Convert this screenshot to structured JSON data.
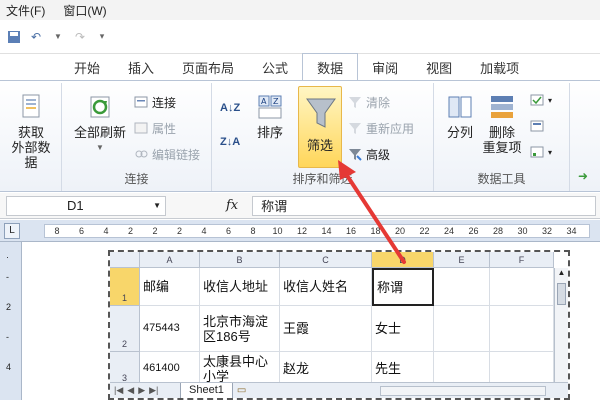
{
  "menubar": {
    "items": [
      "文件(F)",
      "窗口(W)"
    ]
  },
  "tabs": [
    {
      "label": "开始"
    },
    {
      "label": "插入"
    },
    {
      "label": "页面布局"
    },
    {
      "label": "公式"
    },
    {
      "label": "数据",
      "active": true
    },
    {
      "label": "审阅"
    },
    {
      "label": "视图"
    },
    {
      "label": "加载项"
    }
  ],
  "ribbon": {
    "get_external": {
      "label1": "获取",
      "label2": "外部数据"
    },
    "connections": {
      "refresh_all": "全部刷新",
      "connect": "连接",
      "properties": "属性",
      "edit_links": "编辑链接",
      "group_label": "连接"
    },
    "sort_filter": {
      "sort": "排序",
      "filter": "筛选",
      "clear": "清除",
      "reapply": "重新应用",
      "advanced": "高级",
      "group_label": "排序和筛选"
    },
    "data_tools": {
      "split": "分列",
      "remove_dup_1": "删除",
      "remove_dup_2": "重复项",
      "group_label": "数据工具"
    }
  },
  "formula_bar": {
    "name_box": "D1",
    "fx": "fx",
    "content": "称谓"
  },
  "ruler": {
    "numbers": [
      "8",
      "6",
      "4",
      "2",
      "2",
      "2",
      "4",
      "6",
      "8",
      "10",
      "12",
      "14",
      "16",
      "18",
      "20",
      "22",
      "24",
      "26",
      "28",
      "30",
      "32",
      "34"
    ]
  },
  "sheet": {
    "columns": [
      "A",
      "B",
      "C",
      "D",
      "E",
      "F"
    ],
    "rows": [
      {
        "num": "1",
        "cells": [
          "邮编",
          "收信人地址",
          "收信人姓名",
          "称谓",
          "",
          ""
        ]
      },
      {
        "num": "2",
        "cells": [
          "475443",
          "北京市海淀区186号",
          "王霞",
          "女士",
          "",
          ""
        ]
      },
      {
        "num": "3",
        "cells": [
          "461400",
          "太康县中心小学",
          "赵龙",
          "先生",
          "",
          ""
        ]
      }
    ],
    "tab": "Sheet1"
  },
  "colors": {
    "accent": "#f8d66a",
    "arrow": "#e53935",
    "ribbon_border": "#b8c4d6"
  }
}
